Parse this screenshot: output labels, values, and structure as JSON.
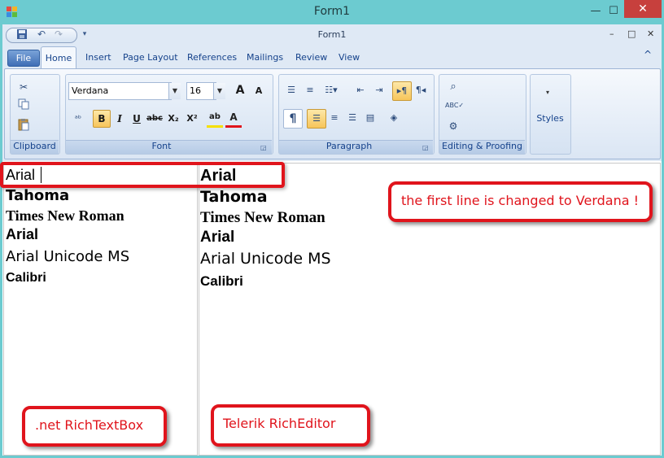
{
  "window": {
    "title": "Form1",
    "minimize_label": "—",
    "maximize_label": "☐",
    "close_label": "✕"
  },
  "inner_window": {
    "title": "Form1",
    "minimize_label": "–",
    "maximize_label": "□",
    "close_label": "✕"
  },
  "quick_access": {
    "items": [
      "save-icon",
      "undo-icon",
      "redo-icon"
    ],
    "customize_label": "▾"
  },
  "ribbon": {
    "file_tab": "File",
    "tabs": [
      "Home",
      "Insert",
      "Page Layout",
      "References",
      "Mailings",
      "Review",
      "View"
    ],
    "active_tab": "Home",
    "collapse_label": "^",
    "groups": {
      "clipboard": {
        "label": "Clipboard"
      },
      "font": {
        "label": "Font",
        "font_name": "Verdana",
        "font_size": "16",
        "grow_label": "A",
        "shrink_label": "A",
        "bold_label": "B",
        "italic_label": "I",
        "underline_label": "U",
        "strike_label": "abc",
        "subscript_label": "X₂",
        "superscript_label": "X²",
        "highlight_label": "ab",
        "color_label": "A"
      },
      "paragraph": {
        "label": "Paragraph",
        "pilcrow_label": "¶"
      },
      "editing": {
        "label": "Editing & Proofing"
      },
      "styles": {
        "label": "Styles"
      }
    }
  },
  "editors": {
    "left_lines": [
      "Arial",
      "Tahoma",
      "Times New Roman",
      "Arial",
      "Arial Unicode MS",
      "Calibri"
    ],
    "right_lines": [
      "Arial",
      "Tahoma",
      "Times New Roman",
      "Arial",
      "Arial Unicode MS",
      "Calibri"
    ]
  },
  "callouts": {
    "top_note": "the first line is changed to Verdana !",
    "left_label": ".net RichTextBox",
    "right_label": "Telerik RichEditor"
  },
  "colors": {
    "accent": "#e0141c",
    "window_frame": "#6ccbd0",
    "ribbon_tab_text": "#15428b",
    "selected_button": "#f7c55a"
  }
}
